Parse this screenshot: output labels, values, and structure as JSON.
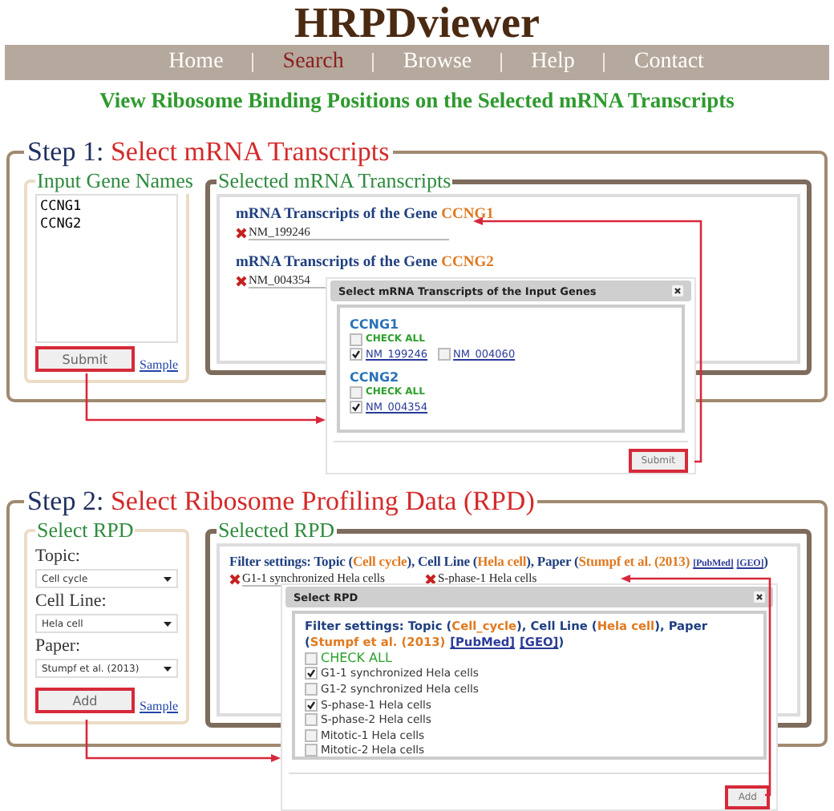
{
  "app": {
    "title": "HRPDviewer"
  },
  "nav": [
    {
      "label": "Home",
      "selected": false
    },
    {
      "label": "Search",
      "selected": true
    },
    {
      "label": "Browse",
      "selected": false
    },
    {
      "label": "Help",
      "selected": false
    },
    {
      "label": "Contact",
      "selected": false
    }
  ],
  "subtitle": "View Ribosome Binding Positions on the Selected mRNA Transcripts",
  "step1": {
    "step": "Step 1:",
    "title": "Select mRNA Transcripts",
    "input_panel": {
      "legend": "Input Gene Names",
      "genes_value": "CCNG1\nCCNG2",
      "submit": "Submit",
      "sample_link": "Sample"
    },
    "selected_panel": {
      "legend": "Selected mRNA Transcripts",
      "groups": [
        {
          "heading": "mRNA Transcripts of the Gene",
          "gene": "CCNG1",
          "transcripts": [
            "NM_199246"
          ]
        },
        {
          "heading": "mRNA Transcripts of the Gene",
          "gene": "CCNG2",
          "transcripts": [
            "NM_004354"
          ]
        }
      ]
    },
    "dialog": {
      "title": "Select mRNA Transcripts of the Input Genes",
      "genes": [
        {
          "name": "CCNG1",
          "check_all": {
            "label": "CHECK ALL",
            "checked": false
          },
          "transcripts": [
            {
              "label": "NM_199246",
              "checked": true
            },
            {
              "label": "NM_004060",
              "checked": false
            }
          ]
        },
        {
          "name": "CCNG2",
          "check_all": {
            "label": "CHECK ALL",
            "checked": false
          },
          "transcripts": [
            {
              "label": "NM_004354",
              "checked": true
            }
          ]
        }
      ],
      "submit": "Submit"
    }
  },
  "step2": {
    "step": "Step 2:",
    "title": "Select Ribosome Profiling Data (RPD)",
    "select_panel": {
      "legend": "Select RPD",
      "fields": [
        {
          "label": "Topic:",
          "value": "Cell cycle"
        },
        {
          "label": "Cell Line:",
          "value": "Hela cell"
        },
        {
          "label": "Paper:",
          "value": "Stumpf et al. (2013)"
        }
      ],
      "add": "Add",
      "sample_link": "Sample"
    },
    "selected_panel": {
      "legend": "Selected RPD",
      "filter": [
        {
          "kind": "text",
          "text": "Filter settings: Topic ("
        },
        {
          "kind": "value",
          "text": "Cell cycle"
        },
        {
          "kind": "text",
          "text": "), Cell Line ("
        },
        {
          "kind": "value",
          "text": "Hela cell"
        },
        {
          "kind": "text",
          "text": "), Paper ("
        },
        {
          "kind": "value",
          "text": "Stumpf et al. (2013)"
        },
        {
          "kind": "link",
          "text": "[PubMed]"
        },
        {
          "kind": "link",
          "text": "[GEO]"
        },
        {
          "kind": "text",
          "text": ")"
        }
      ],
      "samples": [
        "G1-1 synchronized Hela cells",
        "S-phase-1 Hela cells"
      ]
    },
    "dialog": {
      "title": "Select RPD",
      "filter": [
        {
          "kind": "text",
          "text": "Filter settings: Topic ("
        },
        {
          "kind": "value",
          "text": "Cell_cycle"
        },
        {
          "kind": "text",
          "text": "), Cell Line ("
        },
        {
          "kind": "value",
          "text": "Hela cell"
        },
        {
          "kind": "text",
          "text": "), Paper ("
        },
        {
          "kind": "value",
          "text": "Stumpf et al. (2013)"
        },
        {
          "kind": "link",
          "text": "[PubMed]"
        },
        {
          "kind": "link",
          "text": "[GEO]"
        },
        {
          "kind": "text",
          "text": ")"
        }
      ],
      "check_all": {
        "label": "CHECK ALL",
        "checked": false
      },
      "samples": [
        {
          "label": "G1-1 synchronized Hela cells",
          "checked": true
        },
        {
          "label": "G1-2 synchronized Hela cells",
          "checked": false
        },
        {
          "label": "S-phase-1 Hela cells",
          "checked": true
        },
        {
          "label": "S-phase-2 Hela cells",
          "checked": false
        },
        {
          "label": "Mitotic-1 Hela cells",
          "checked": false
        },
        {
          "label": "Mitotic-2 Hela cells",
          "checked": false
        }
      ],
      "add": "Add"
    }
  }
}
